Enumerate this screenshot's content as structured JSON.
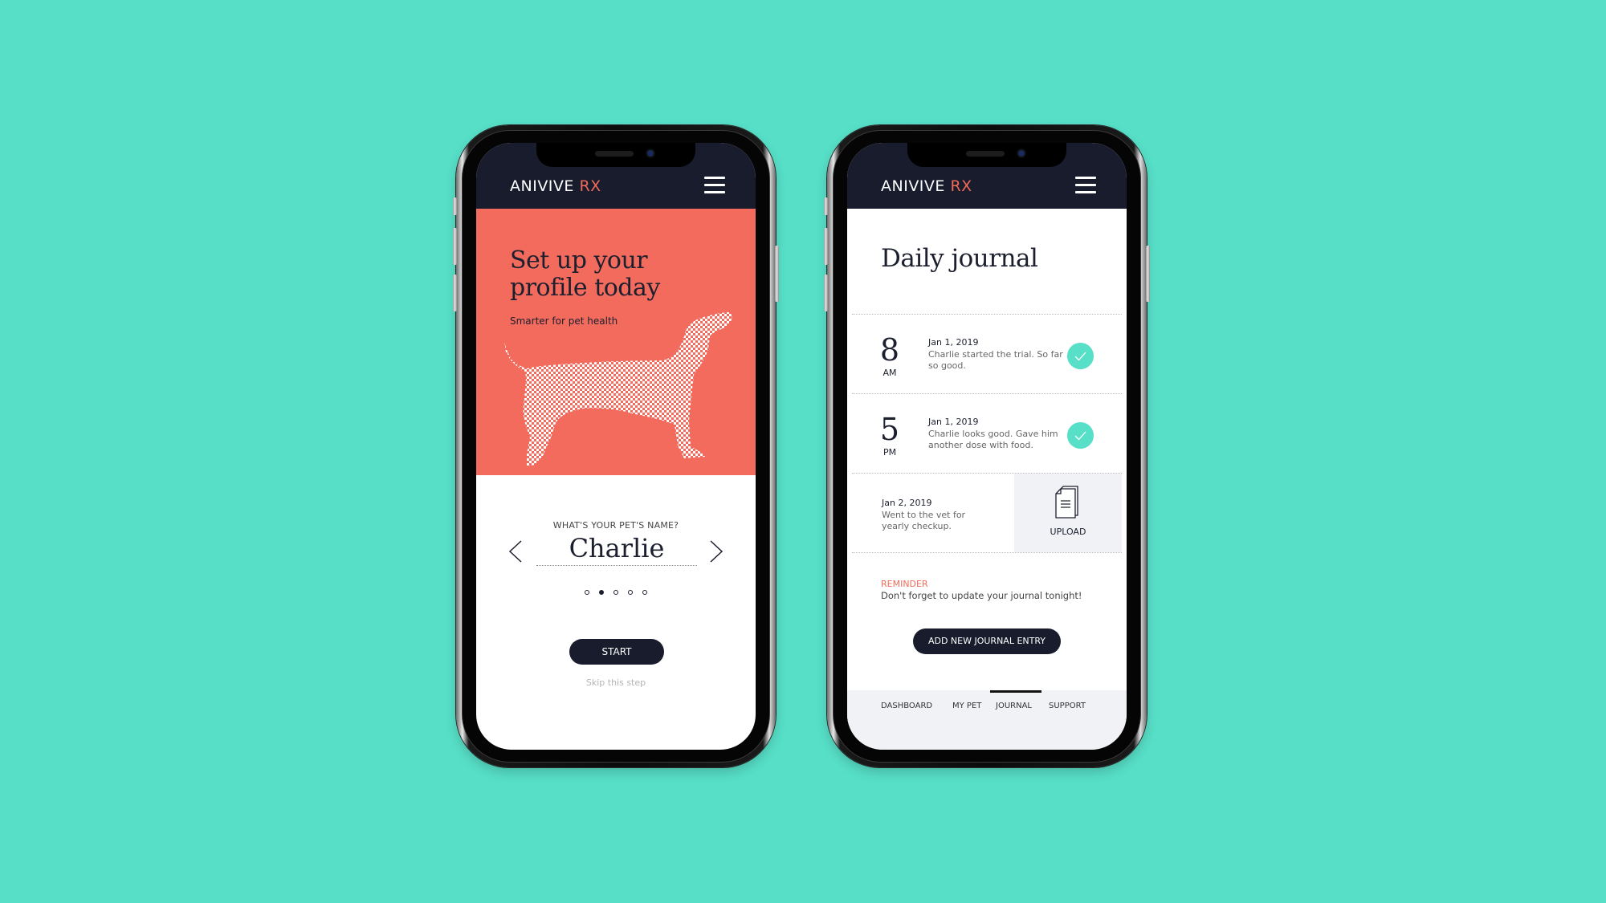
{
  "brand": {
    "name": "ANIVIVE",
    "suffix": "RX",
    "accent_color": "#f06b5a",
    "navy_color": "#181c2c",
    "teal_color": "#57dfc7"
  },
  "left_screen": {
    "hero": {
      "title": "Set up your profile today",
      "subtitle": "Smarter for pet health",
      "illustration": "dachshund-dog"
    },
    "pet_name_prompt": "WHAT'S YOUR PET'S NAME?",
    "pet_name_value": "Charlie",
    "prev_icon": "chevron-left-icon",
    "next_icon": "chevron-right-icon",
    "pagination": {
      "total": 5,
      "active_index": 1
    },
    "start_label": "START",
    "skip_label": "Skip this step"
  },
  "right_screen": {
    "title": "Daily journal",
    "entries": [
      {
        "hour": "8",
        "period": "AM",
        "date": "Jan 1, 2019",
        "text": "Charlie started the trial. So far so good.",
        "status": "check-icon"
      },
      {
        "hour": "5",
        "period": "PM",
        "date": "Jan 1, 2019",
        "text": "Charlie looks good. Gave him another dose with food.",
        "status": "check-icon"
      }
    ],
    "upload_entry": {
      "date": "Jan 2, 2019",
      "text": "Went to the vet for yearly checkup.",
      "upload_label": "UPLOAD",
      "upload_icon": "document-icon"
    },
    "reminder": {
      "label": "REMINDER",
      "text": "Don't forget to update your journal tonight!"
    },
    "add_entry_label": "ADD NEW JOURNAL ENTRY",
    "tabs": [
      {
        "label": "DASHBOARD",
        "active": false
      },
      {
        "label": "MY PET",
        "active": false
      },
      {
        "label": "JOURNAL",
        "active": true
      },
      {
        "label": "SUPPORT",
        "active": false
      }
    ]
  }
}
